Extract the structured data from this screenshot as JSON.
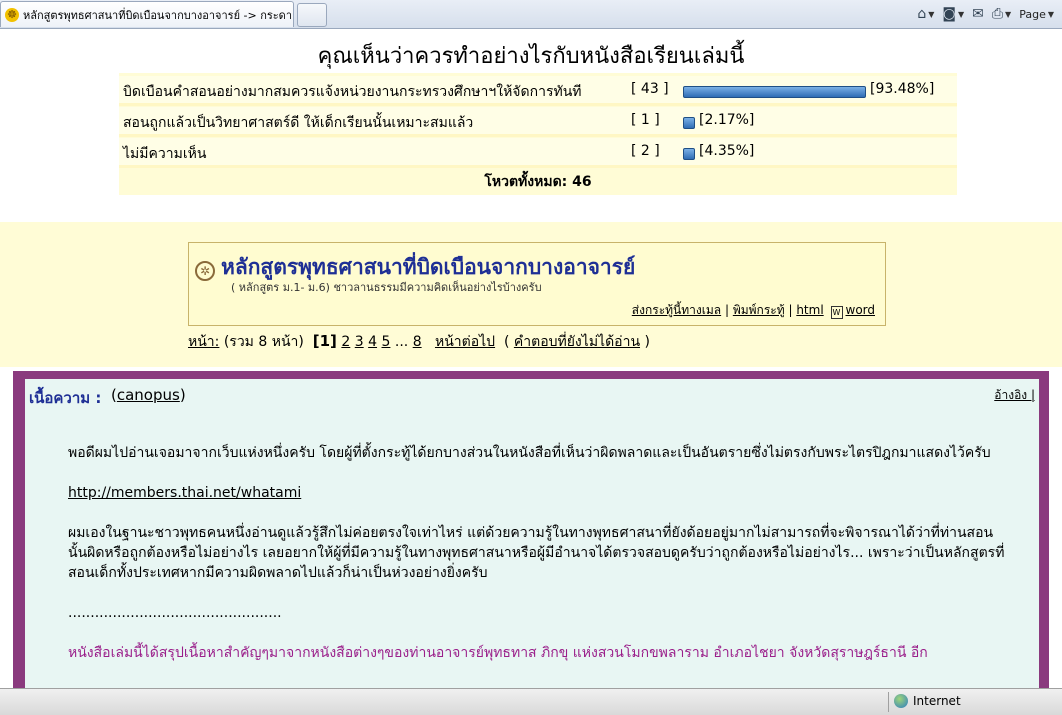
{
  "browser": {
    "tab_title": "หลักสูตรพุทธศาสนาที่บิดเบือนจากบางอาจารย์ -> กระดา...",
    "page_menu": "Page",
    "status_zone": "Internet"
  },
  "poll": {
    "title": "คุณเห็นว่าควรทำอย่างไรกับหนังสือเรียนเล่มนี้",
    "options": [
      {
        "label": "บิดเบือนคำสอนอย่างมากสมควรแจ้งหน่วยงานกระทรวงศึกษาฯให้จัดการทันที",
        "count": "[ 43 ]",
        "percent": "[93.48%]",
        "fraction": 0.9348
      },
      {
        "label": "สอนถูกแล้วเป็นวิทยาศาสตร์ดี ให้เด็กเรียนนั้นเหมาะสมแล้ว",
        "count": "[ 1 ]",
        "percent": "[2.17%]",
        "fraction": 0.0217
      },
      {
        "label": "ไม่มีความเห็น",
        "count": "[ 2 ]",
        "percent": "[4.35%]",
        "fraction": 0.0435
      }
    ],
    "total": "โหวตทั้งหมด: 46"
  },
  "topic": {
    "title": "หลักสูตรพุทธศาสนาที่บิดเบือนจากบางอาจารย์",
    "subtitle": "( หลักสูตร ม.1- ม.6) ชาวลานธรรมมีความคิดเห็นอย่างไรบ้างครับ",
    "links": {
      "email": "ส่งกระทู้นี้ทางเมล",
      "print": "พิมพ์กระทู้",
      "sep": "|",
      "html": "html",
      "word": "word"
    }
  },
  "pager": {
    "label": "หน้า:",
    "total": "(รวม 8 หน้า)",
    "current": "[1]",
    "pages": [
      "2",
      "3",
      "4",
      "5"
    ],
    "ellipsis": "...",
    "last": "8",
    "next": "หน้าต่อไป",
    "unread_open": "(",
    "unread": "คำตอบที่ยังไม่ได้อ่าน",
    "unread_close": ")"
  },
  "post": {
    "label": "เนื้อความ :",
    "author_open": "(",
    "author": "canopus",
    "author_close": ")",
    "quote": "อ้างอิง |",
    "p1": "พอดีผมไปอ่านเจอมาจากเว็บแห่งหนึ่งครับ โดยผู้ที่ตั้งกระทู้ได้ยกบางส่วนในหนังสือที่เห็นว่าผิดพลาดและเป็นอันตรายซึ่งไม่ตรงกับพระไตรปิฎกมาแสดงไว้ครับ",
    "link": "http://members.thai.net/whatami",
    "p2": "ผมเองในฐานะชาวพุทธคนหนึ่งอ่านดูแล้วรู้สึกไม่ค่อยตรงใจเท่าไหร่ แต่ด้วยความรู้ในทางพุทธศาสนาที่ยังด้อยอยู่มากไม่สามารถที่จะพิจารณาได้ว่าที่ท่านสอนนั้นผิดหรือถูกต้องหรือไม่อย่างไร เลยอยากให้ผู้ที่มีความรู้ในทางพุทธศาสนาหรือผู้มีอำนาจได้ตรวจสอบดูครับว่าถูกต้องหรือไม่อย่างไร... เพราะว่าเป็นหลักสูตรที่สอนเด็กทั้งประเทศหากมีความผิดพลาดไปแล้วก็น่าเป็นห่วงอย่างยิ่งครับ",
    "dots": "................................................",
    "p3": "หนังสือเล่มนี้ได้สรุปเนื้อหาสำคัญๆมาจากหนังสือต่างๆของท่านอาจารย์พุทธทาส ภิกขุ แห่งสวนโมกขพลาราม อำเภอไชยา จังหวัดสุราษฎร์ธานี อีก"
  }
}
